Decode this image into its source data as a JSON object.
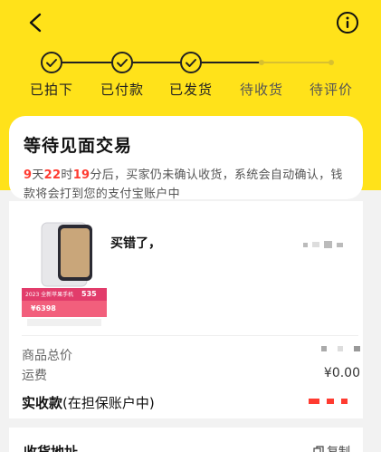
{
  "nav": {
    "back_icon": "chevron-left-icon",
    "info_icon": "info-circle-icon"
  },
  "steps": [
    {
      "label": "已拍下",
      "done": true
    },
    {
      "label": "已付款",
      "done": true
    },
    {
      "label": "已发货",
      "done": true
    },
    {
      "label": "待收货",
      "done": false
    },
    {
      "label": "待评价",
      "done": false
    }
  ],
  "status": {
    "title": "等待见面交易",
    "days": "9",
    "days_unit": "天",
    "hours": "22",
    "hours_unit": "时",
    "minutes": "19",
    "desc_rest": "分后，买家仍未确认收货，系统会自动确认，钱款将会打到您的支付宝账户中"
  },
  "product": {
    "name": "买错了，",
    "thumb_promo_a": "535",
    "thumb_promo_b": "¥6398",
    "thumb_banner": "2023 全新苹果手机"
  },
  "summary": {
    "goods_total_label": "商品总价",
    "shipping_label": "运费",
    "shipping_value": "¥0.00",
    "received_label_bold": "实收款",
    "received_label_note": "(在担保账户中)"
  },
  "address": {
    "title": "收货地址",
    "copy_label": "复制",
    "copy_icon": "copy-icon"
  },
  "colors": {
    "header_yellow": "#ffe21a",
    "accent_red": "#ff3b30"
  }
}
